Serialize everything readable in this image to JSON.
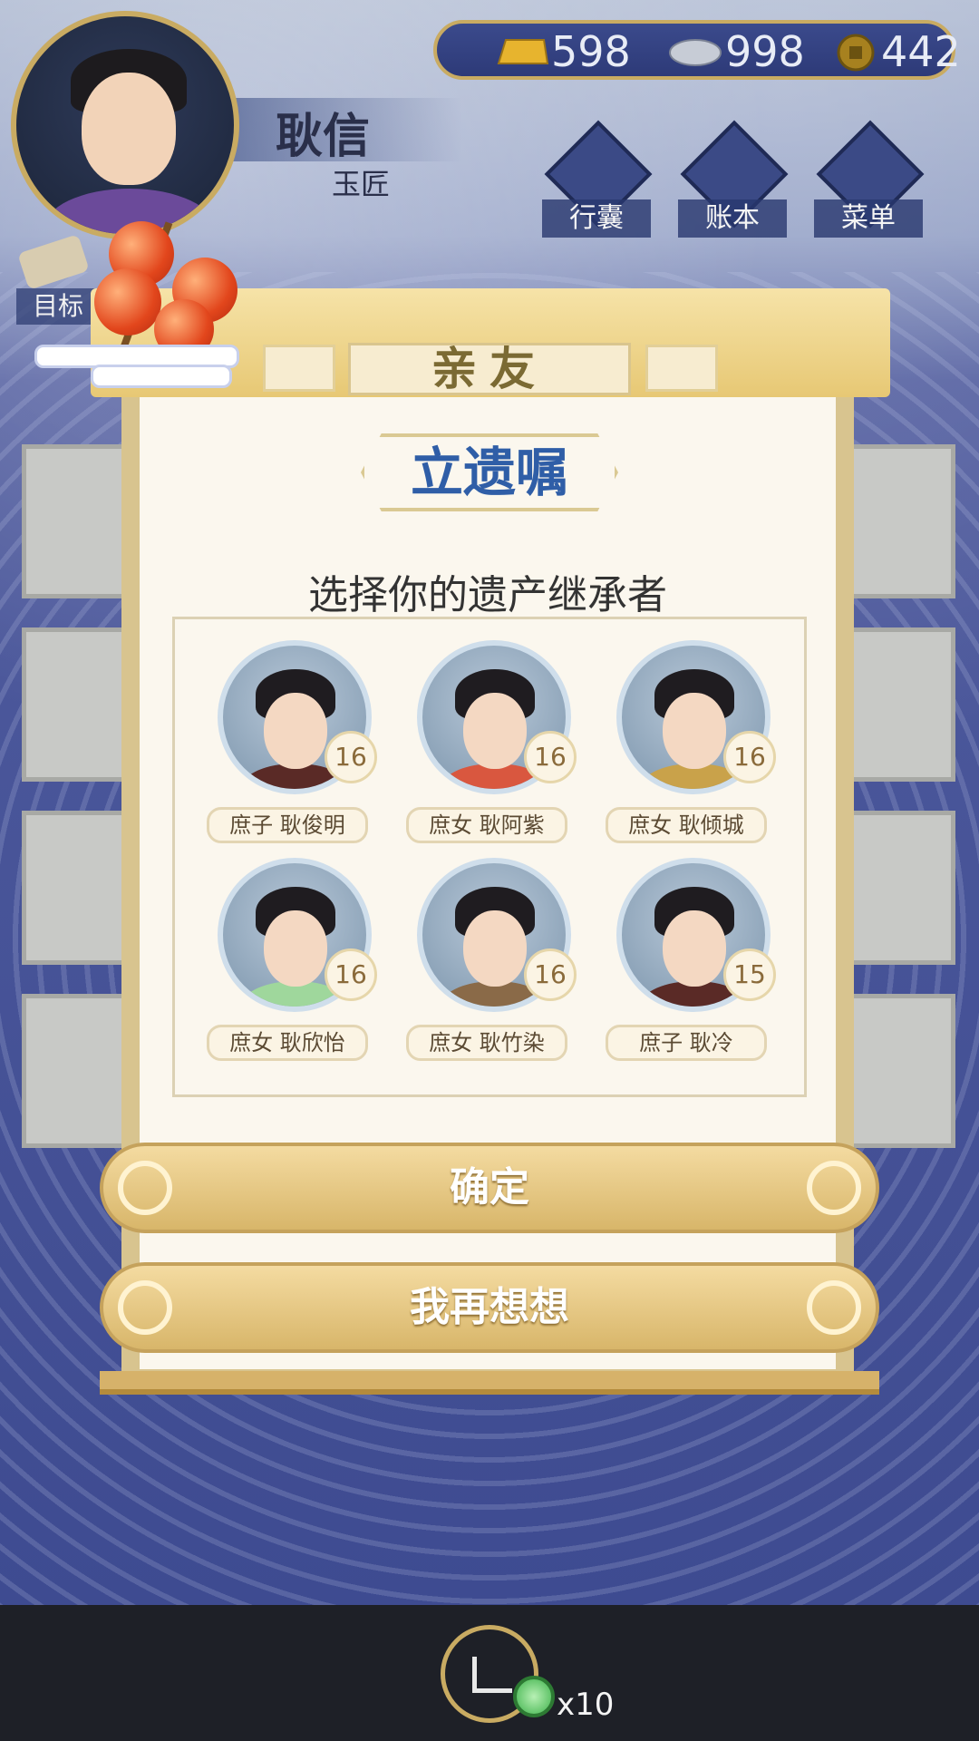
{
  "player": {
    "name": "耿信",
    "title": "玉匠"
  },
  "currency": {
    "gold": "598",
    "silver": "998",
    "coin": "442"
  },
  "top_buttons": [
    {
      "label": "行囊"
    },
    {
      "label": "账本"
    },
    {
      "label": "菜单"
    }
  ],
  "goal_label": "目标",
  "panel": {
    "tab_title": "亲友",
    "banner_title": "立遗嘱",
    "subtitle": "选择你的遗产继承者"
  },
  "children": [
    {
      "label": "庶子 耿俊明",
      "age": "16"
    },
    {
      "label": "庶女 耿阿紫",
      "age": "16"
    },
    {
      "label": "庶女 耿倾城",
      "age": "16"
    },
    {
      "label": "庶女 耿欣怡",
      "age": "16"
    },
    {
      "label": "庶女 耿竹染",
      "age": "16"
    },
    {
      "label": "庶子 耿冷",
      "age": "15"
    }
  ],
  "buttons": {
    "confirm": "确定",
    "reconsider": "我再想想"
  },
  "bottom": {
    "jade_count": "x10"
  },
  "colors": {
    "gold_border": "#c9ab62",
    "banner_text": "#2f5ea7",
    "panel_bg": "#fbf7ee"
  }
}
